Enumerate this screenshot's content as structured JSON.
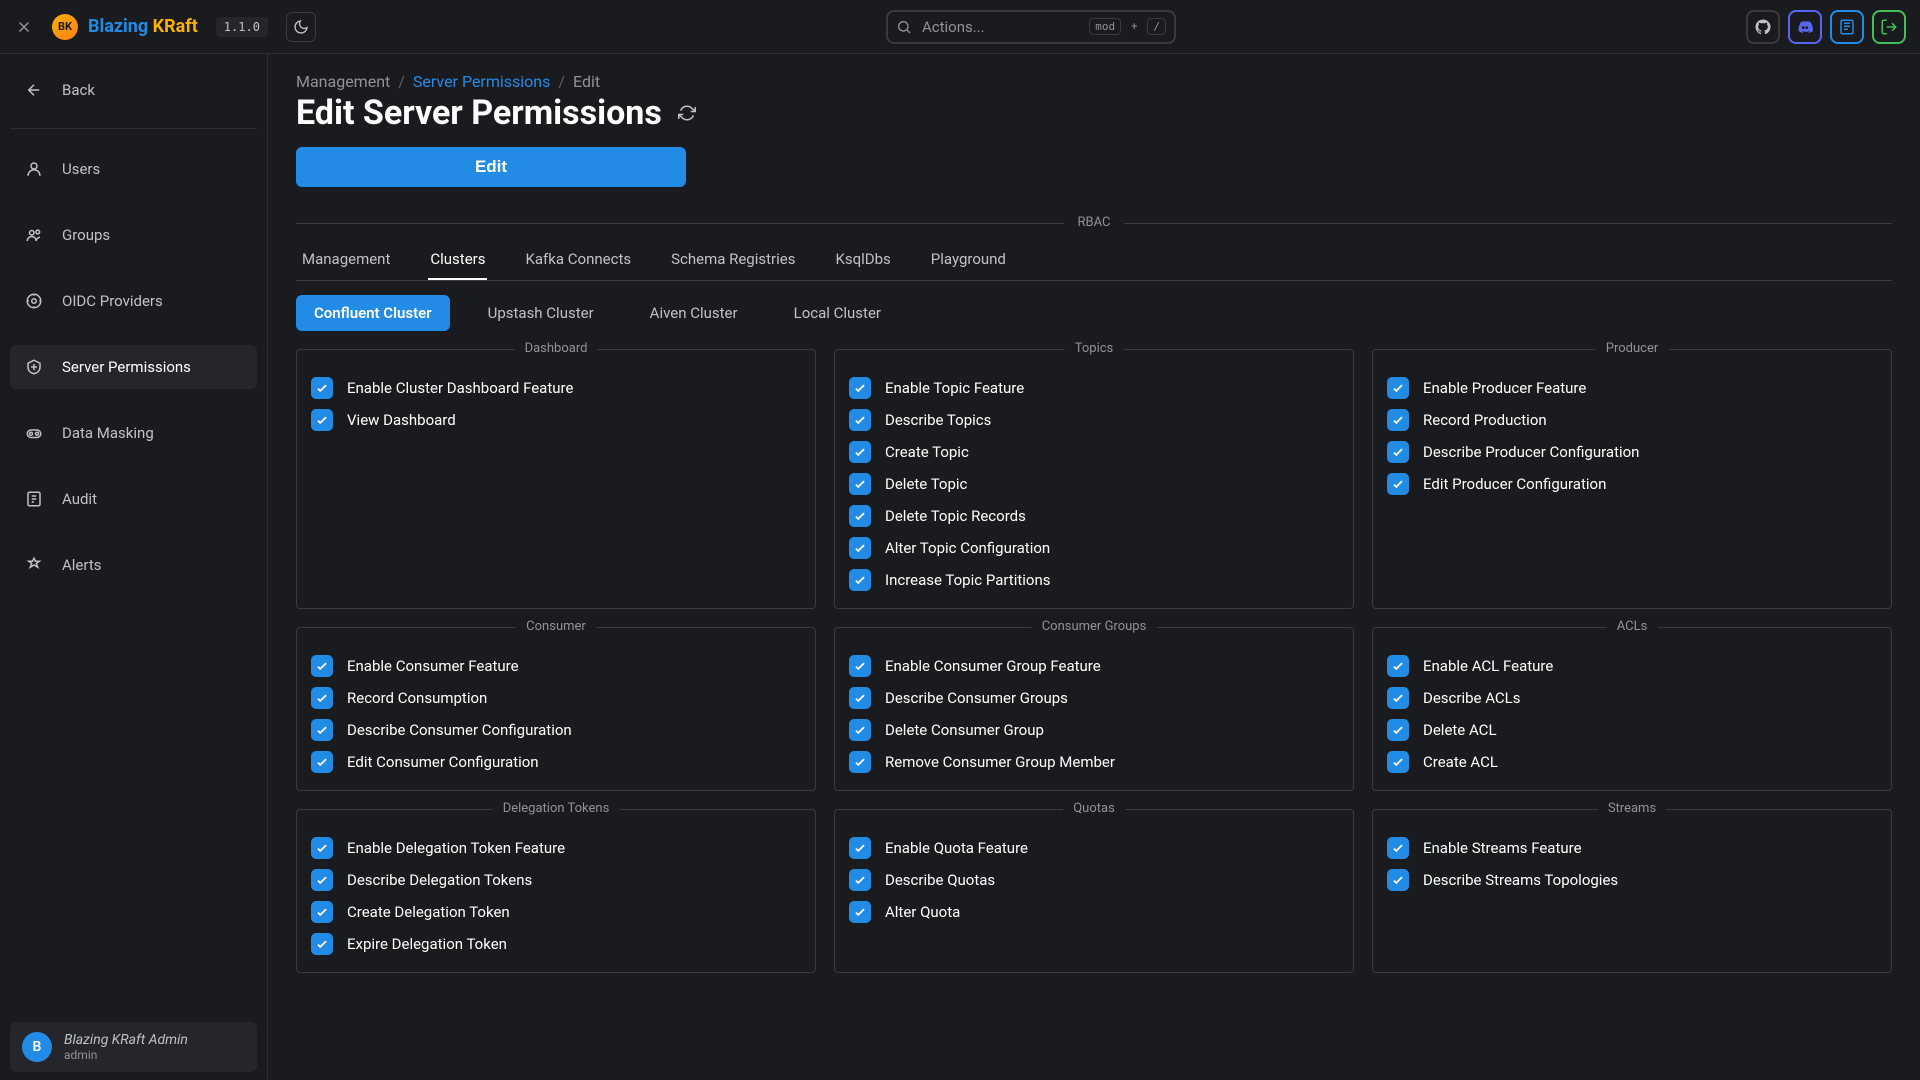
{
  "brand": {
    "logo_text": "BK",
    "part1": "Blazing ",
    "part2": "KRaft"
  },
  "version": "1.1.0",
  "search": {
    "placeholder": "Actions...",
    "kbd_mod": "mod",
    "kbd_plus": "+",
    "kbd_slash": "/"
  },
  "sidebar": {
    "back": "Back",
    "items": [
      "Users",
      "Groups",
      "OIDC Providers",
      "Server Permissions",
      "Data Masking",
      "Audit",
      "Alerts"
    ],
    "active_index": 3
  },
  "footer_user": {
    "initial": "B",
    "name": "Blazing KRaft Admin",
    "role": "admin"
  },
  "breadcrumb": {
    "a": "Management",
    "b": "Server Permissions",
    "c": "Edit"
  },
  "page_title": "Edit Server Permissions",
  "edit_button": "Edit",
  "rbac_label": "RBAC",
  "tabs": [
    "Management",
    "Clusters",
    "Kafka Connects",
    "Schema Registries",
    "KsqlDbs",
    "Playground"
  ],
  "active_tab": 1,
  "subtabs": [
    "Confluent Cluster",
    "Upstash Cluster",
    "Aiven Cluster",
    "Local Cluster"
  ],
  "active_subtab": 0,
  "cards": [
    {
      "title": "Dashboard",
      "items": [
        "Enable Cluster Dashboard Feature",
        "View Dashboard"
      ]
    },
    {
      "title": "Topics",
      "items": [
        "Enable Topic Feature",
        "Describe Topics",
        "Create Topic",
        "Delete Topic",
        "Delete Topic Records",
        "Alter Topic Configuration",
        "Increase Topic Partitions"
      ]
    },
    {
      "title": "Producer",
      "items": [
        "Enable Producer Feature",
        "Record Production",
        "Describe Producer Configuration",
        "Edit Producer Configuration"
      ]
    },
    {
      "title": "Consumer",
      "items": [
        "Enable Consumer Feature",
        "Record Consumption",
        "Describe Consumer Configuration",
        "Edit Consumer Configuration"
      ]
    },
    {
      "title": "Consumer Groups",
      "items": [
        "Enable Consumer Group Feature",
        "Describe Consumer Groups",
        "Delete Consumer Group",
        "Remove Consumer Group Member"
      ]
    },
    {
      "title": "ACLs",
      "items": [
        "Enable ACL Feature",
        "Describe ACLs",
        "Delete ACL",
        "Create ACL"
      ]
    },
    {
      "title": "Delegation Tokens",
      "items": [
        "Enable Delegation Token Feature",
        "Describe Delegation Tokens",
        "Create Delegation Token",
        "Expire Delegation Token"
      ]
    },
    {
      "title": "Quotas",
      "items": [
        "Enable Quota Feature",
        "Describe Quotas",
        "Alter Quota"
      ]
    },
    {
      "title": "Streams",
      "items": [
        "Enable Streams Feature",
        "Describe Streams Topologies"
      ]
    }
  ]
}
